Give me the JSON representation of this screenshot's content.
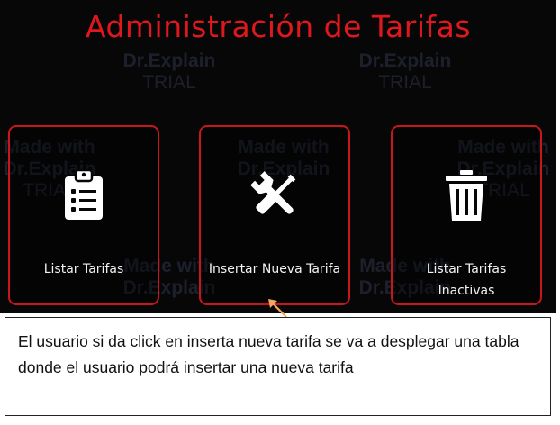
{
  "header": {
    "title": "Administración de Tarifas"
  },
  "cards": [
    {
      "label_lines": [
        "Listar Tarifas"
      ],
      "icon": "clipboard-list-icon"
    },
    {
      "label_lines": [
        "Insertar Nueva Tarifa"
      ],
      "icon": "wrench-screwdriver-icon"
    },
    {
      "label_lines": [
        "Listar Tarifas",
        "Inactivas"
      ],
      "icon": "trash-icon"
    }
  ],
  "annotation": {
    "arrow_icon": "arrow-icon",
    "text": "El usuario si da click en inserta nueva tarifa se va a desplegar una tabla donde el usuario podrá insertar una nueva tarifa"
  },
  "watermark": {
    "line1": "Made with",
    "line2": "Dr.Explain",
    "line3": "TRIAL"
  },
  "colors": {
    "accent": "#e0181e",
    "card_border": "#c8161c",
    "arrow": "#f4a460",
    "background": "#070707"
  }
}
